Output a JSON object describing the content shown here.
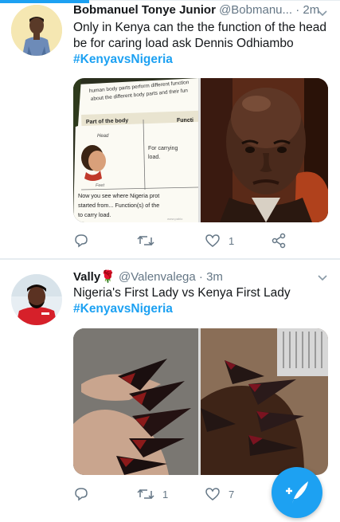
{
  "tweets": [
    {
      "name": "Bobmanuel Tonye Junior",
      "handle": "@Bobmanu...",
      "time": "· 2m",
      "text": "Only in Kenya can the the function of the head be for caring load ask Dennis Odhiambo",
      "hashtag": "#KenyavsNigeria",
      "textbook": {
        "top1": "human body parts perform different function",
        "top2": "about the different body parts and their fun",
        "col1": "Part of the body",
        "col2": "Functi",
        "cell_head": "Head",
        "cell_func": "For carrying load.",
        "cell_foot": "Feet",
        "caption": "Now you see where Nigeria prot started from... Function(s) of the to carry load.",
        "brand": "www.pablo"
      },
      "likes": "1",
      "retweets": "",
      "replies": ""
    },
    {
      "name": "Vally🌹",
      "handle": "@Valenvalega",
      "time": "· 3m",
      "text": "Nigeria's First Lady vs Kenya First Lady",
      "hashtag": "#KenyavsNigeria",
      "retweets": "1",
      "likes": "7",
      "replies": ""
    }
  ],
  "icons": {
    "reply": "reply-icon",
    "retweet": "retweet-icon",
    "like": "heart-icon",
    "share": "share-icon",
    "compose": "compose-tweet-icon"
  },
  "colors": {
    "accent": "#1da1f2",
    "text": "#14171a",
    "secondary": "#657786"
  }
}
